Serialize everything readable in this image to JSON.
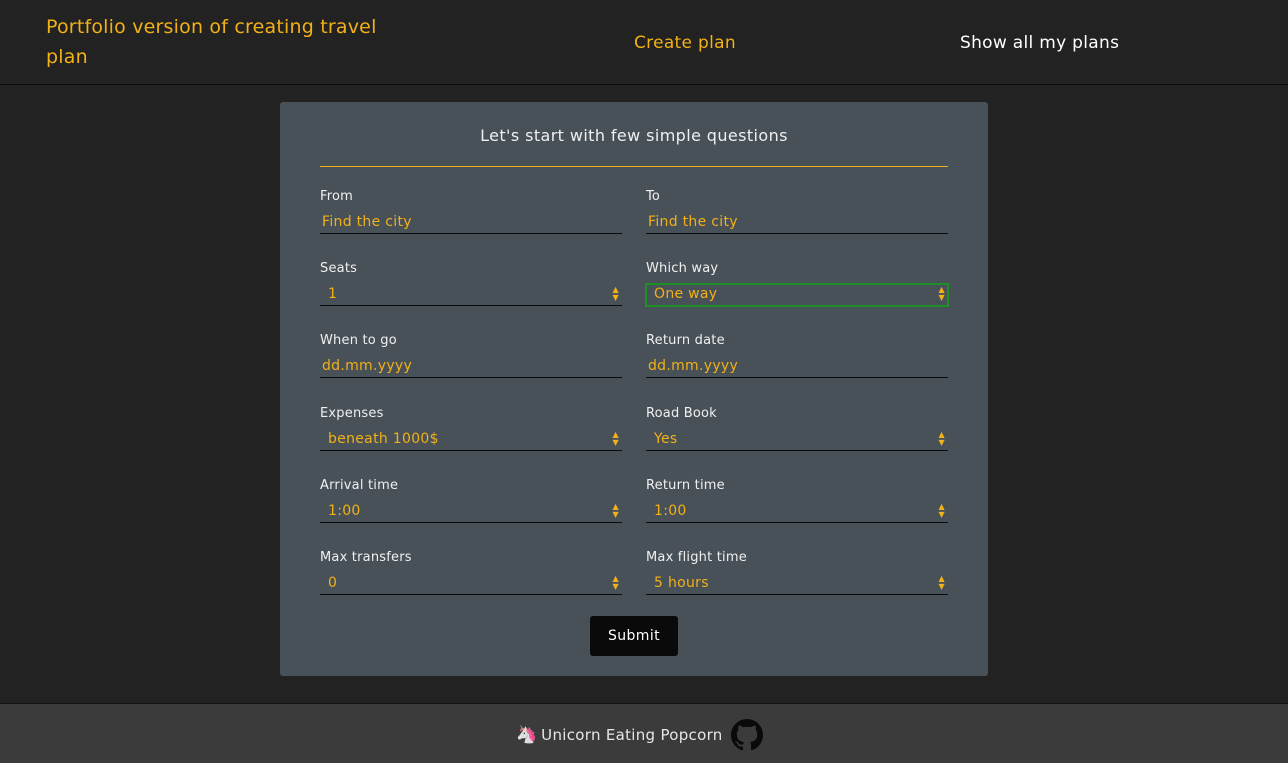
{
  "header": {
    "brand": "Portfolio version of creating travel plan",
    "nav_create": "Create plan",
    "nav_show": "Show all my plans"
  },
  "form": {
    "title": "Let's start with few simple questions",
    "from": {
      "label": "From",
      "placeholder": "Find the city"
    },
    "to": {
      "label": "To",
      "placeholder": "Find the city"
    },
    "seats": {
      "label": "Seats",
      "value": "1"
    },
    "which_way": {
      "label": "Which way",
      "value": "One way"
    },
    "when_to_go": {
      "label": "When to go",
      "placeholder": "dd.mm.yyyy"
    },
    "return_date": {
      "label": "Return date",
      "placeholder": "dd.mm.yyyy"
    },
    "expenses": {
      "label": "Expenses",
      "value": "beneath 1000$"
    },
    "road_book": {
      "label": "Road Book",
      "value": "Yes"
    },
    "arrival_time": {
      "label": "Arrival time",
      "value": "1:00"
    },
    "return_time": {
      "label": "Return time",
      "value": "1:00"
    },
    "max_transfers": {
      "label": "Max transfers",
      "value": "0"
    },
    "max_flight_time": {
      "label": "Max flight time",
      "value": "5 hours"
    },
    "submit_label": "Submit"
  },
  "footer": {
    "emoji": "🦄",
    "text": "Unicorn Eating Popcorn",
    "icon": "github-icon"
  },
  "colors": {
    "accent": "#f2b117",
    "card": "#485058",
    "background": "#222222",
    "focus": "#1c8f25"
  }
}
